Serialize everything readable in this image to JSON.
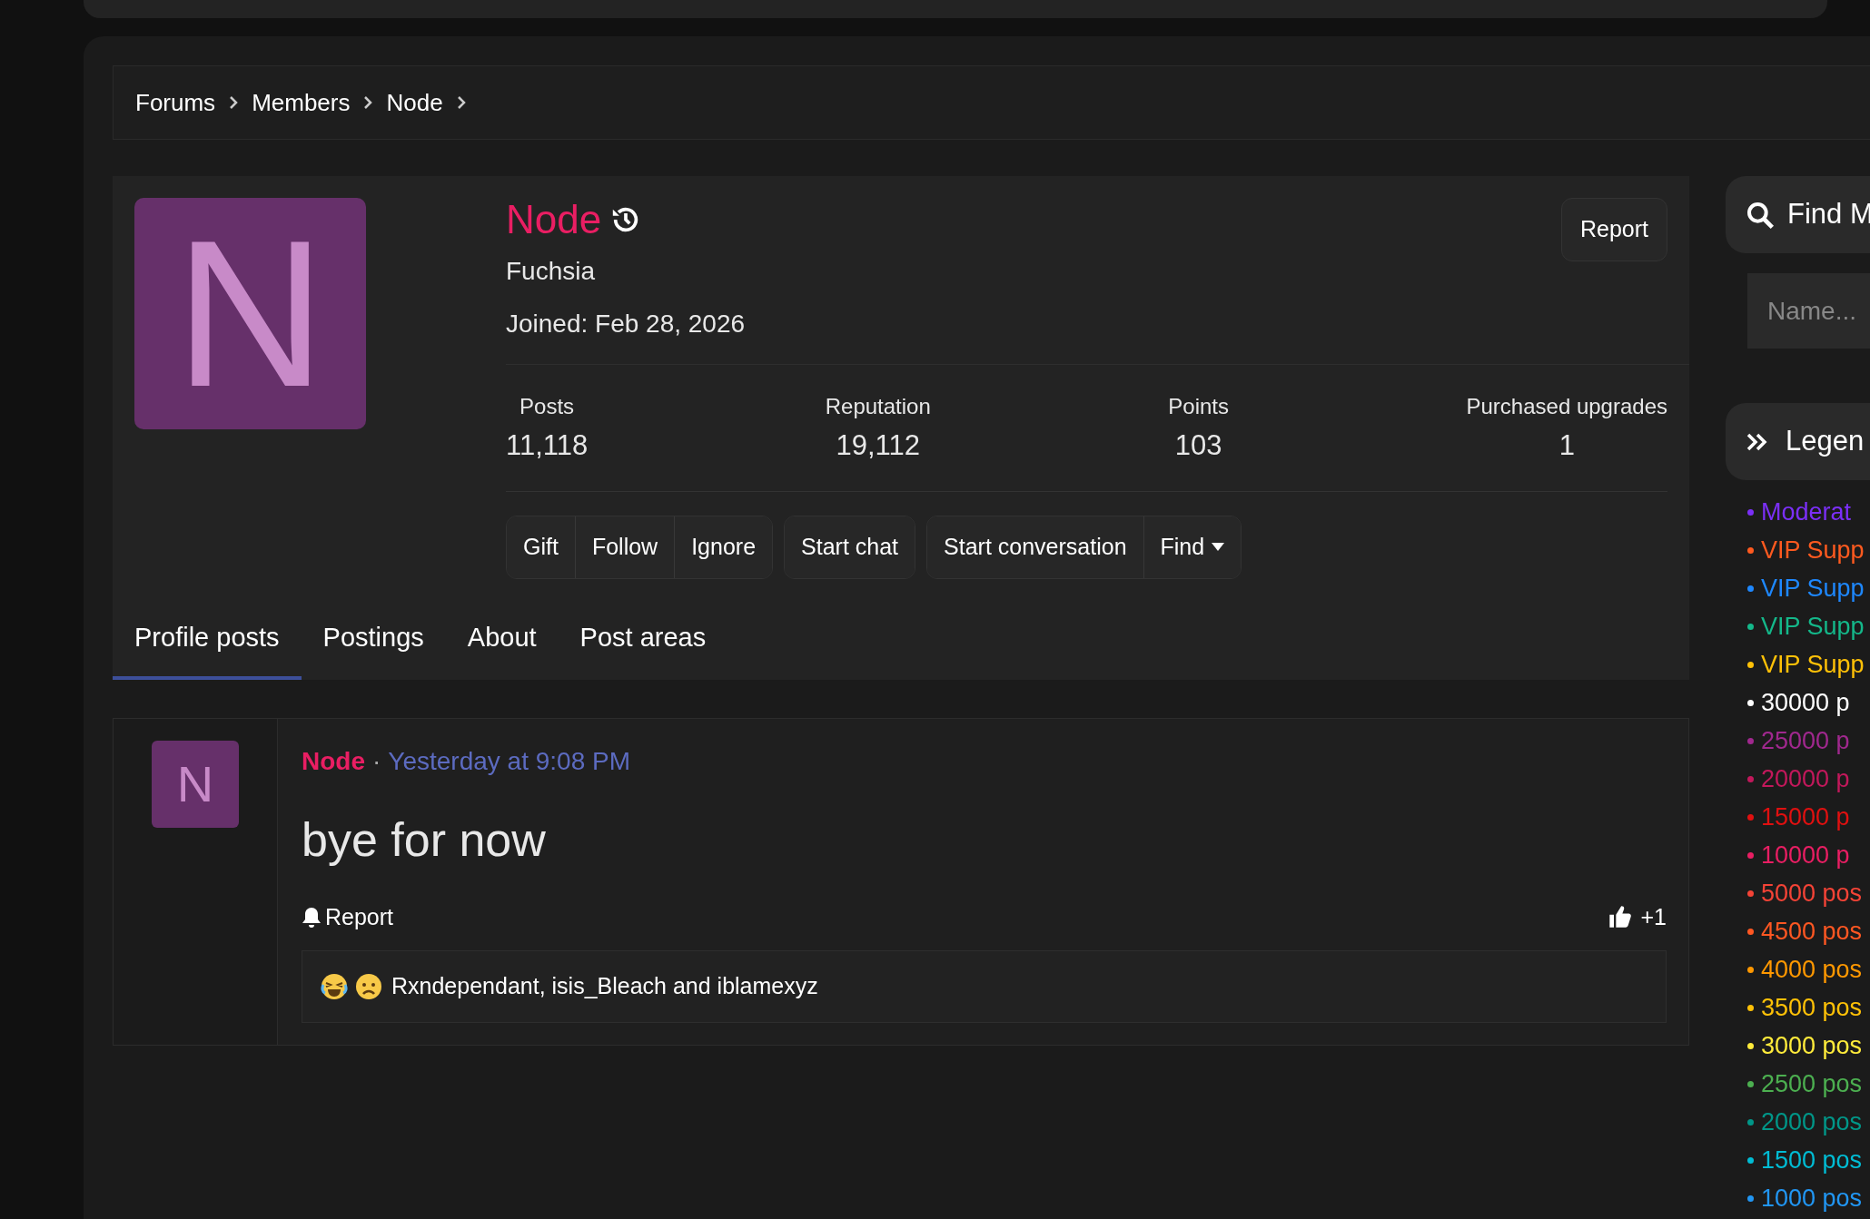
{
  "breadcrumb": [
    "Forums",
    "Members",
    "Node"
  ],
  "profile": {
    "avatar_letter": "N",
    "name": "Node",
    "title": "Fuchsia",
    "joined": "Joined: Feb 28, 2026",
    "report": "Report",
    "stats": [
      {
        "label": "Posts",
        "value": "11,118"
      },
      {
        "label": "Reputation",
        "value": "19,112"
      },
      {
        "label": "Points",
        "value": "103"
      },
      {
        "label": "Purchased upgrades",
        "value": "1"
      }
    ],
    "button_groups": [
      [
        {
          "label": "Gift",
          "kind": "plain"
        },
        {
          "label": "Follow",
          "kind": "plain"
        },
        {
          "label": "Ignore",
          "kind": "plain"
        }
      ],
      [
        {
          "label": "Start chat",
          "kind": "plain"
        }
      ],
      [
        {
          "label": "Start conversation",
          "kind": "plain"
        },
        {
          "label": "Find",
          "kind": "dropdown"
        }
      ]
    ]
  },
  "tabs": [
    {
      "label": "Profile posts",
      "selected": true
    },
    {
      "label": "Postings",
      "selected": false
    },
    {
      "label": "About",
      "selected": false
    },
    {
      "label": "Post areas",
      "selected": false
    }
  ],
  "post": {
    "avatar_letter": "N",
    "author": "Node",
    "separator": "·",
    "time": "Yesterday at 9:08 PM",
    "text": "bye for now",
    "report": "Report",
    "reaction_count": "+1",
    "reactions_text": "Rxndependant, isis_Bleach and iblamexyz"
  },
  "sidebar": {
    "find_title": "Find M",
    "name_placeholder": "Name...",
    "legend_title": "Legen",
    "legend": [
      {
        "label": "Moderat",
        "color": "#7b2ff7"
      },
      {
        "label": "VIP Supp",
        "color": "#ff5a1f"
      },
      {
        "label": "VIP Supp",
        "color": "#1e88ff"
      },
      {
        "label": "VIP Supp",
        "color": "#14b88a"
      },
      {
        "label": "VIP Supp",
        "color": "#ffc107"
      },
      {
        "label": "30000 p",
        "color": "#ffffff"
      },
      {
        "label": "25000 p",
        "color": "#a0288e"
      },
      {
        "label": "20000 p",
        "color": "#c2185b"
      },
      {
        "label": "15000 p",
        "color": "#e01010"
      },
      {
        "label": "10000 p",
        "color": "#e91e63"
      },
      {
        "label": "5000 pos",
        "color": "#f44336"
      },
      {
        "label": "4500 pos",
        "color": "#ff5722"
      },
      {
        "label": "4000 pos",
        "color": "#ff9800"
      },
      {
        "label": "3500 pos",
        "color": "#ffc107"
      },
      {
        "label": "3000 pos",
        "color": "#ffeb3b"
      },
      {
        "label": "2500 pos",
        "color": "#4caf50"
      },
      {
        "label": "2000 pos",
        "color": "#009688"
      },
      {
        "label": "1500 pos",
        "color": "#00bcd4"
      },
      {
        "label": "1000 pos",
        "color": "#2196f3"
      }
    ]
  }
}
